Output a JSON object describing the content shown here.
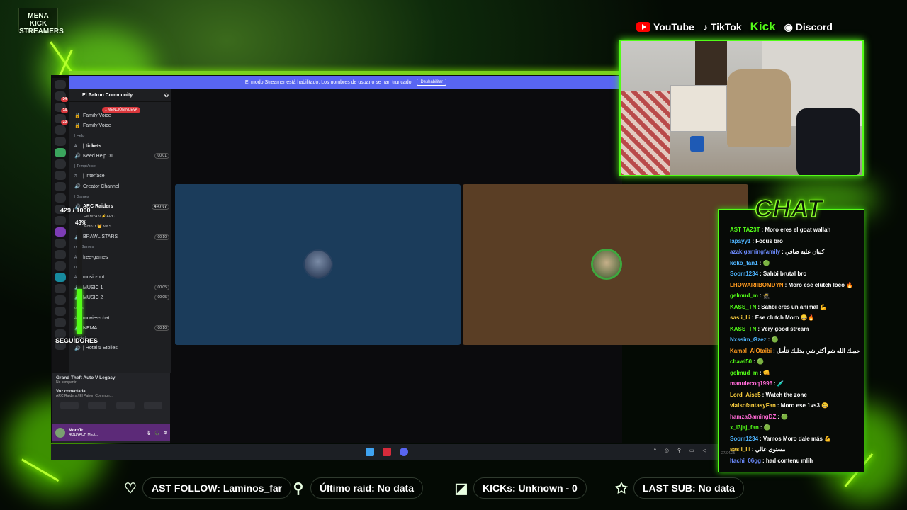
{
  "overlay": {
    "logo_text": "MENA KICK STREAMERS",
    "socials": [
      {
        "label": "YouTube",
        "icon": "youtube-icon"
      },
      {
        "label": "TikTok",
        "icon": "tiktok-icon"
      },
      {
        "label": "Kick",
        "icon": "kick-icon"
      },
      {
        "label": "Discord",
        "icon": "discord-icon"
      }
    ],
    "follow_goal": {
      "text": "429 / 1000",
      "percent_label": "43%",
      "progress": 0.43,
      "caption": "SEGUIDORES"
    },
    "chat_title": "CHAT",
    "widgets": [
      {
        "label": "AST FOLLOW: Laminos_far",
        "icon": "heart-icon"
      },
      {
        "label": "Último raid: No data",
        "icon": "person-icon"
      },
      {
        "label": "KICKs: Unknown - 0",
        "icon": "kick-icon"
      },
      {
        "label": "LAST SUB: No data",
        "icon": "star-icon"
      }
    ],
    "accent": "#53fc18"
  },
  "discord": {
    "banner_text": "El modo Streamer está habilitado. Los nombres de usuario se han truncado.",
    "banner_button": "Deshabilitar",
    "server_name": "El Patron Community",
    "mention_badge": "1 MENCIÓN NUEVA",
    "channels": [
      {
        "type": "voice",
        "label": "Family Voice",
        "g": "🔒"
      },
      {
        "type": "voice",
        "label": "Family Voice",
        "g": "🔒"
      },
      {
        "type": "category",
        "label": "| Help"
      },
      {
        "type": "text",
        "label": "| tickets",
        "g": "#",
        "active": true
      },
      {
        "type": "voice",
        "label": "Need Help 01",
        "g": "🔊",
        "time": "00 01"
      },
      {
        "type": "category",
        "label": "| TempVoice"
      },
      {
        "type": "text",
        "label": "| interface",
        "g": "#"
      },
      {
        "type": "voice",
        "label": "Creator Channel",
        "g": "🔊"
      },
      {
        "type": "category",
        "label": "| Games"
      },
      {
        "type": "voice",
        "label": "ARC Raiders",
        "g": "🔊",
        "time": "4:47:07",
        "active": true
      },
      {
        "type": "sub",
        "label": "He MzA 9 ⚡ARC"
      },
      {
        "type": "sub",
        "label": "MoroTr 👑 MKS"
      },
      {
        "type": "voice",
        "label": "BRAWL STARS",
        "g": "🔊",
        "time": "00 10"
      },
      {
        "type": "category",
        "label": "ree Games"
      },
      {
        "type": "text",
        "label": "free-games",
        "g": "#"
      },
      {
        "type": "category",
        "label": "usic"
      },
      {
        "type": "text",
        "label": "music-bot",
        "g": "#"
      },
      {
        "type": "voice",
        "label": "MUSIC 1",
        "g": "🔊",
        "time": "00 05"
      },
      {
        "type": "voice",
        "label": "MUSIC 2",
        "g": "🔊",
        "time": "00 05"
      },
      {
        "type": "category",
        "label": "ovies"
      },
      {
        "type": "text",
        "label": "movies-chat",
        "g": "#"
      },
      {
        "type": "voice",
        "label": "NEMA",
        "g": "🔊",
        "time": "00 10"
      },
      {
        "type": "category",
        "label": "| Hotel"
      },
      {
        "type": "voice",
        "label": "| Hotel 5 Etoiles",
        "g": "🔊"
      }
    ],
    "activity": {
      "game": "Grand Theft Auto V Legacy",
      "sub": "No compartir"
    },
    "voice": {
      "status": "Voz conectada",
      "channel": "ARC Raiders / El Patron Commun..."
    },
    "user": {
      "name": "MoroTr",
      "status": "ЖЗДNACH MEЗ..."
    }
  },
  "chat": {
    "timestamp": "27/04/25",
    "messages": [
      {
        "user": "AST TAZ3T",
        "color": "#53fc18",
        "text": ": Moro eres el goat wallah"
      },
      {
        "user": "lapayy1",
        "color": "#4fb5ff",
        "text": ": Focus bro"
      },
      {
        "user": "azakigamingfamily",
        "color": "#6d8cff",
        "text": ": كيبان عليه صافي"
      },
      {
        "user": "koko_fan1",
        "color": "#4fb5ff",
        "text": ": 🟢"
      },
      {
        "user": "Soom1234",
        "color": "#4fb5ff",
        "text": ": Sahbi brutal bro"
      },
      {
        "user": "LHOWARIIBOMDYN",
        "color": "#ff9a1f",
        "text": ": Moro ese clutch loco 🔥"
      },
      {
        "user": "gelmud_m",
        "color": "#53fc18",
        "text": ": 🥷"
      },
      {
        "user": "KASS_TN",
        "color": "#53fc18",
        "text": ": Sahbi eres un animal 💪"
      },
      {
        "user": "sasii_lii",
        "color": "#ffd23f",
        "text": ": Ese clutch Moro 😄🔥"
      },
      {
        "user": "KASS_TN",
        "color": "#53fc18",
        "text": ": Very good stream"
      },
      {
        "user": "Nxssim_Gzez",
        "color": "#4fb5ff",
        "text": ": 🟢"
      },
      {
        "user": "Kamal_AlOtaibi",
        "color": "#ff9a1f",
        "text": ": حبيبك الله شو أكثر شي يخليك تتأمل"
      },
      {
        "user": "chawi50",
        "color": "#53fc18",
        "text": ": 🟢"
      },
      {
        "user": "gelmud_m",
        "color": "#53fc18",
        "text": ": 👊"
      },
      {
        "user": "manulecoq1996",
        "color": "#ff6ad5",
        "text": ": 🧪"
      },
      {
        "user": "Lord_Aise5",
        "color": "#ffd23f",
        "text": ": Watch the zone"
      },
      {
        "user": "vialsofantasyFan",
        "color": "#ffd23f",
        "text": ": Moro ese 1vs3 😄"
      },
      {
        "user": "hamzaGamingDZ",
        "color": "#ff6ad5",
        "text": ": 🟢"
      },
      {
        "user": "x_l3jaj_fan",
        "color": "#53fc18",
        "text": ": 🟢"
      },
      {
        "user": "Soom1234",
        "color": "#4fb5ff",
        "text": ": Vamos Moro dale más 💪"
      },
      {
        "user": "sasii_lii",
        "color": "#ffd23f",
        "text": ": مستوى عالي"
      },
      {
        "user": "Itachi_06gg",
        "color": "#6d8cff",
        "text": ": had contenu mlih"
      }
    ]
  }
}
